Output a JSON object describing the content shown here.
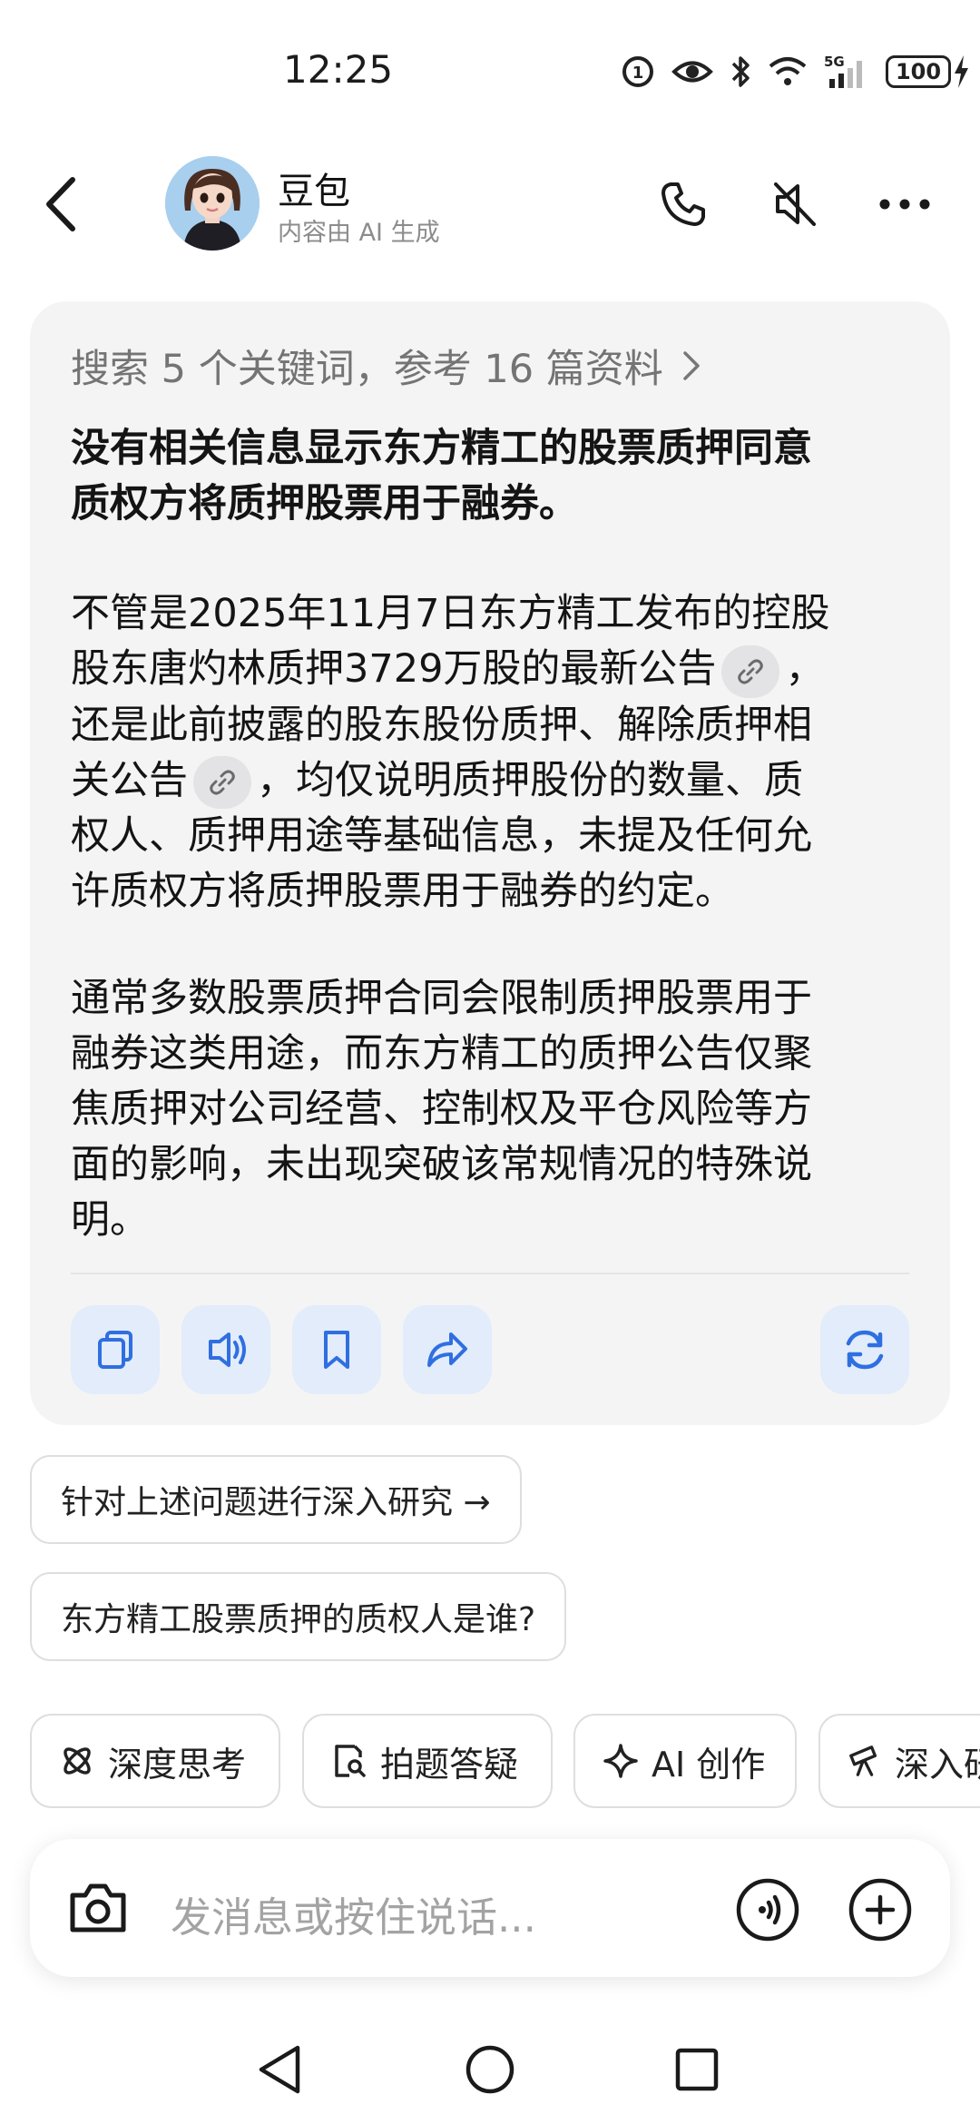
{
  "status_bar": {
    "time": "12:25",
    "battery": "100",
    "network": "5G"
  },
  "header": {
    "bot_name": "豆包",
    "subtitle": "内容由 AI 生成"
  },
  "answer": {
    "search_summary": "搜索 5 个关键词，参考 16 篇资料",
    "headline_line1": "没有相关信息显示东方精工的股票质押同意",
    "headline_line2": "质权方将质押股票用于融券。",
    "p1_l1": "不管是2025年11月7日东方精工发布的控股",
    "p1_l2_a": "股东唐灼林质押3729万股的最新公告",
    "p1_l2_b": "，",
    "p1_l3": "还是此前披露的股东股份质押、解除质押相",
    "p1_l4_a": "关公告",
    "p1_l4_b": "，均仅说明质押股份的数量、质",
    "p1_l5": "权人、质押用途等基础信息，未提及任何允",
    "p1_l6": "许质权方将质押股票用于融券的约定。",
    "p2_l1": "通常多数股票质押合同会限制质押股票用于",
    "p2_l2": "融券这类用途，而东方精工的质押公告仅聚",
    "p2_l3": "焦质押对公司经营、控制权及平仓风险等方",
    "p2_l4": "面的影响，未出现突破该常规情况的特殊说",
    "p2_l5": "明。"
  },
  "actions": {
    "copy_icon": "copy-icon",
    "speaker_icon": "speaker-icon",
    "bookmark_icon": "bookmark-icon",
    "share_icon": "share-icon",
    "regenerate_icon": "refresh-icon"
  },
  "suggestions": [
    {
      "label": "针对上述问题进行深入研究 →"
    },
    {
      "label": "东方精工股票质押的质权人是谁?"
    }
  ],
  "quick_chips": [
    {
      "label": "深度思考"
    },
    {
      "label": "拍题答疑"
    },
    {
      "label": "AI 创作"
    },
    {
      "label": "深入研"
    }
  ],
  "input": {
    "placeholder": "发消息或按住说话..."
  },
  "colors": {
    "accent_blue": "#2f6fe0",
    "card_bg": "#f4f4f5",
    "action_bg": "#e2ecfb"
  }
}
